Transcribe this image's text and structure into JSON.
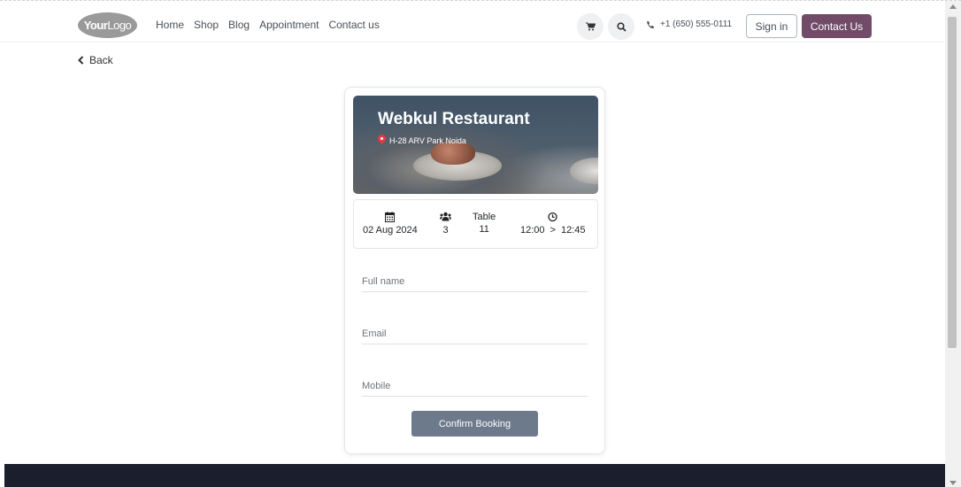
{
  "header": {
    "logo_bold": "Your",
    "logo_light": "Logo",
    "nav": [
      "Home",
      "Shop",
      "Blog",
      "Appointment",
      "Contact us"
    ],
    "cart_icon": "cart-icon",
    "search_icon": "search-icon",
    "phone": "+1 (650) 555-0111",
    "sign_in": "Sign in",
    "contact_us": "Contact Us"
  },
  "back_label": "Back",
  "restaurant": {
    "name": "Webkul Restaurant",
    "address": "H-28 ARV Park Noida"
  },
  "booking": {
    "date": "02 Aug 2024",
    "guests": "3",
    "table_label": "Table",
    "table_number": "11",
    "time_start": "12:00",
    "time_separator": ">",
    "time_end": "12:45"
  },
  "form": {
    "full_name_placeholder": "Full name",
    "email_placeholder": "Email",
    "mobile_placeholder": "Mobile",
    "confirm_label": "Confirm Booking"
  },
  "colors": {
    "brand": "#714b67",
    "confirm_button": "#6c7a8c",
    "footer": "#1b1f2d",
    "pin": "#e63946"
  }
}
